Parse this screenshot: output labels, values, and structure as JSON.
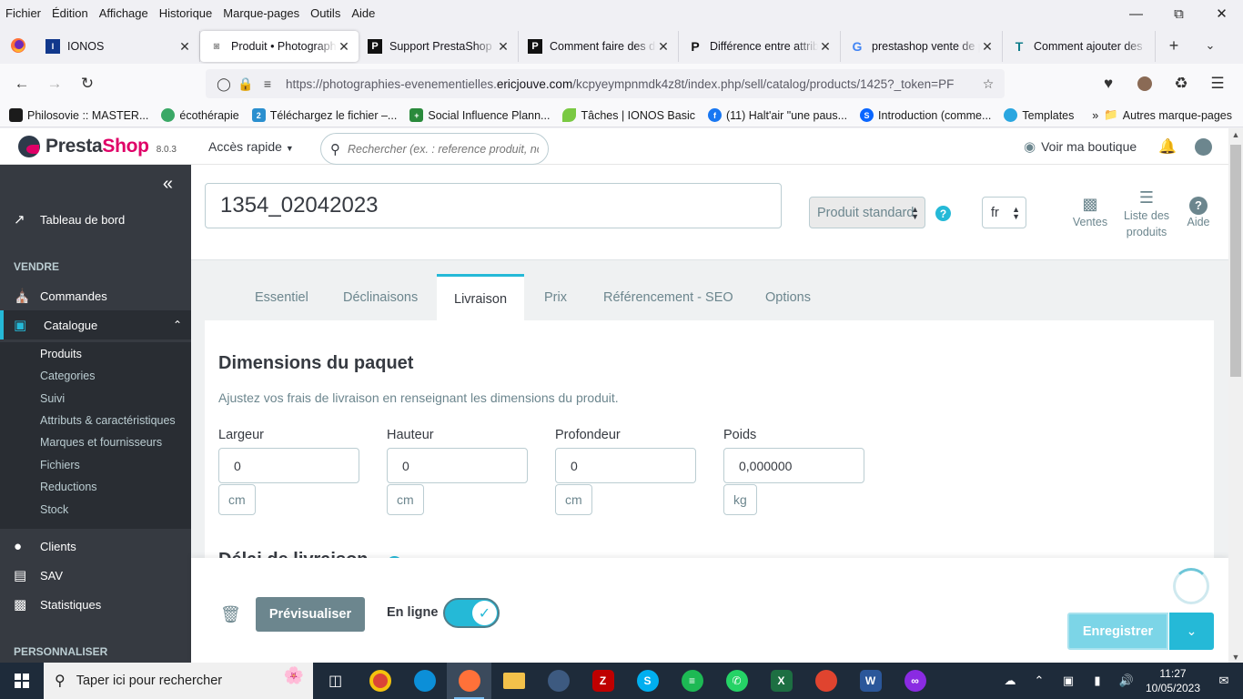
{
  "menubar": [
    "Fichier",
    "Édition",
    "Affichage",
    "Historique",
    "Marque-pages",
    "Outils",
    "Aide"
  ],
  "tabs": [
    {
      "title": "IONOS",
      "favicon": "IONOS"
    },
    {
      "title": "Produit • Photographie",
      "favicon": "PS",
      "active": true
    },
    {
      "title": "Support PrestaShop | P",
      "favicon": "P"
    },
    {
      "title": "Comment faire des décl",
      "favicon": "P"
    },
    {
      "title": "Différence entre attribu",
      "favicon": "P"
    },
    {
      "title": "prestashop vente de ph",
      "favicon": "G"
    },
    {
      "title": "Comment ajouter des",
      "favicon": "T"
    }
  ],
  "urlbar": {
    "url_prefix": "https://photographies-evenementielles.",
    "url_domain": "ericjouve.com",
    "url_suffix": "/kcpyeympnmdk4z8t/index.php/sell/catalog/products/1425?_token=PF"
  },
  "bookmarks": [
    {
      "label": "Philosovie :: MASTER...",
      "color": "#1b1b1b"
    },
    {
      "label": "écothérapie",
      "color": "#3aa866"
    },
    {
      "label": "Téléchargez le fichier –...",
      "color": "#2a8fcf"
    },
    {
      "label": "Social Influence Plann...",
      "color": "#2a8a3c"
    },
    {
      "label": "Tâches | IONOS Basic",
      "color": "#7ac943"
    },
    {
      "label": "(11) Halt'air \"une paus...",
      "color": "#1877f2"
    },
    {
      "label": "Introduction (comme...",
      "color": "#0a66ff"
    },
    {
      "label": "Templates",
      "color": "#2aa6e0"
    }
  ],
  "bookmarks_other": "Autres marque-pages",
  "ps": {
    "brand_presta": "Presta",
    "brand_shop": "Shop",
    "version": "8.0.3",
    "quick_access": "Accès rapide",
    "search_placeholder": "Rechercher (ex. : reference produit, no",
    "view_shop": "Voir ma boutique"
  },
  "sidebar": {
    "dashboard": "Tableau de bord",
    "section_sell": "VENDRE",
    "orders": "Commandes",
    "catalog": "Catalogue",
    "catalog_sub": [
      "Produits",
      "Categories",
      "Suivi",
      "Attributs & caractéristiques",
      "Marques et fournisseurs",
      "Fichiers",
      "Reductions",
      "Stock"
    ],
    "clients": "Clients",
    "sav": "SAV",
    "stats": "Statistiques",
    "section_customize": "PERSONNALISER"
  },
  "product": {
    "name": "1354_02042023",
    "type": "Produit standard",
    "lang": "fr",
    "tool_sales": "Ventes",
    "tool_list_1": "Liste des",
    "tool_list_2": "produits",
    "tool_help": "Aide"
  },
  "product_tabs": [
    "Essentiel",
    "Déclinaisons",
    "Livraison",
    "Prix",
    "Référencement - SEO",
    "Options"
  ],
  "shipping": {
    "title": "Dimensions du paquet",
    "description": "Ajustez vos frais de livraison en renseignant les dimensions du produit.",
    "fields": [
      {
        "label": "Largeur",
        "value": "0",
        "unit": "cm"
      },
      {
        "label": "Hauteur",
        "value": "0",
        "unit": "cm"
      },
      {
        "label": "Profondeur",
        "value": "0",
        "unit": "cm"
      },
      {
        "label": "Poids",
        "value": "0,000000",
        "unit": "kg"
      }
    ],
    "next_section": "Délai de livraison"
  },
  "footer": {
    "preview": "Prévisualiser",
    "online": "En ligne",
    "save": "Enregistrer"
  },
  "taskbar": {
    "search_placeholder": "Taper ici pour rechercher",
    "time": "11:27",
    "date": "10/05/2023"
  }
}
